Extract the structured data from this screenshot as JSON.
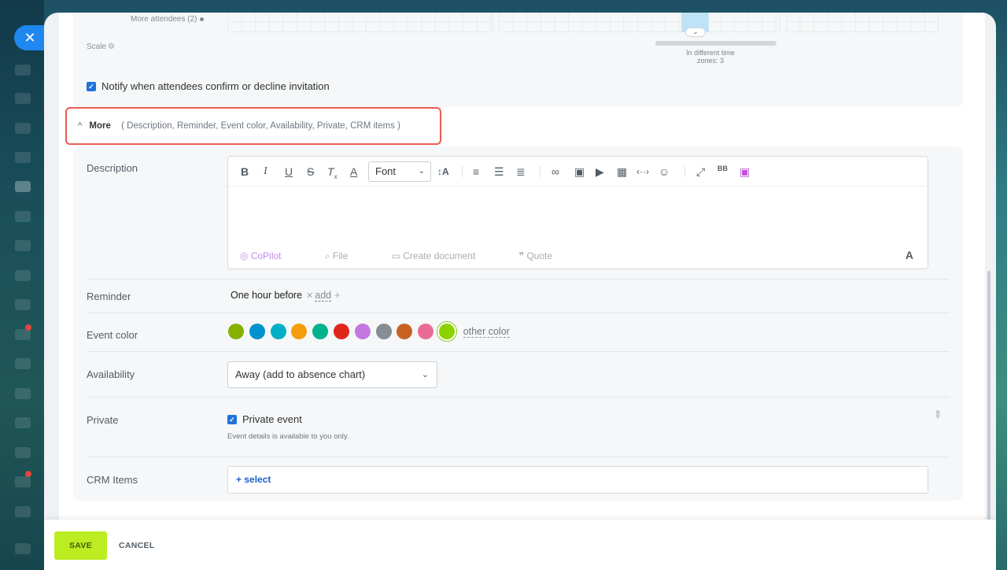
{
  "close_icon_glyph": "✕",
  "attendees": {
    "more_attendees": "More attendees (2)",
    "scale_label": "Scale",
    "timezone_note_line1": "In different time",
    "timezone_note_line2": "zones: 3",
    "notify_label": "Notify when attendees confirm or decline invitation",
    "notify_checked": true
  },
  "more_toggle": {
    "label": "More",
    "items": "( Description,  Reminder,  Event color,  Availability,  Private,  CRM items )"
  },
  "description": {
    "label": "Description",
    "font_select": "Font",
    "footer": {
      "copilot": "CoPilot",
      "file": "File",
      "create_document": "Create document",
      "quote": "Quote"
    }
  },
  "reminder": {
    "label": "Reminder",
    "value": "One hour before",
    "add_label": "add"
  },
  "event_color": {
    "label": "Event color",
    "swatches": [
      "#86b100",
      "#0092cc",
      "#00afc7",
      "#f59e0b",
      "#00b38c",
      "#e0251b",
      "#c377e0",
      "#868d95",
      "#c86223",
      "#ea6b93",
      "#8cd100"
    ],
    "selected_index": 10,
    "other_color_label": "other color"
  },
  "availability": {
    "label": "Availability",
    "value": "Away (add to absence chart)"
  },
  "private": {
    "label": "Private",
    "checkbox_label": "Private event",
    "checked": true,
    "note": "Event details is available to you only."
  },
  "crm": {
    "label": "CRM Items",
    "select_label": "+  select"
  },
  "footer": {
    "save": "SAVE",
    "cancel": "CANCEL"
  }
}
